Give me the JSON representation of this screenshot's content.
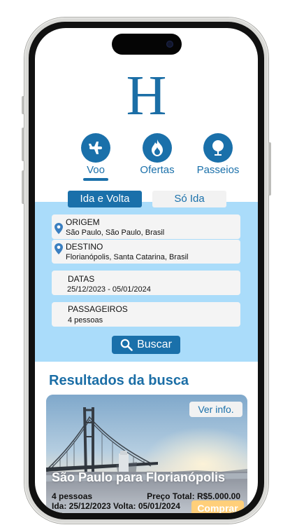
{
  "brand": {
    "logo_letter": "H"
  },
  "nav": {
    "items": [
      {
        "label": "Voo",
        "icon": "airplane-icon",
        "active": true
      },
      {
        "label": "Ofertas",
        "icon": "flame-icon",
        "active": false
      },
      {
        "label": "Passeios",
        "icon": "tree-icon",
        "active": false
      }
    ]
  },
  "trip_type": {
    "round_trip": "Ida e Volta",
    "one_way": "Só Ida",
    "selected": "round_trip"
  },
  "form": {
    "origin": {
      "title": "ORIGEM",
      "value": "São Paulo, São Paulo, Brasil"
    },
    "destination": {
      "title": "DESTINO",
      "value": "Florianópolis, Santa Catarina, Brasil"
    },
    "dates": {
      "title": "DATAS",
      "value": "25/12/2023 - 05/01/2024"
    },
    "passengers": {
      "title": "PASSAGEIROS",
      "value": "4 pessoas"
    },
    "search_label": "Buscar"
  },
  "results": {
    "title": "Resultados da busca",
    "card": {
      "info_label": "Ver info.",
      "title": "São Paulo para Florianópolis",
      "passengers": "4 pessoas",
      "price": "Preço Total: R$5.000.00",
      "dates": "Ida: 25/12/2023  Volta: 05/01/2024",
      "buy_label": "Comprar"
    }
  },
  "colors": {
    "primary": "#1a70aa",
    "panel": "#aadcfa",
    "buy": "#ffcf7a"
  }
}
